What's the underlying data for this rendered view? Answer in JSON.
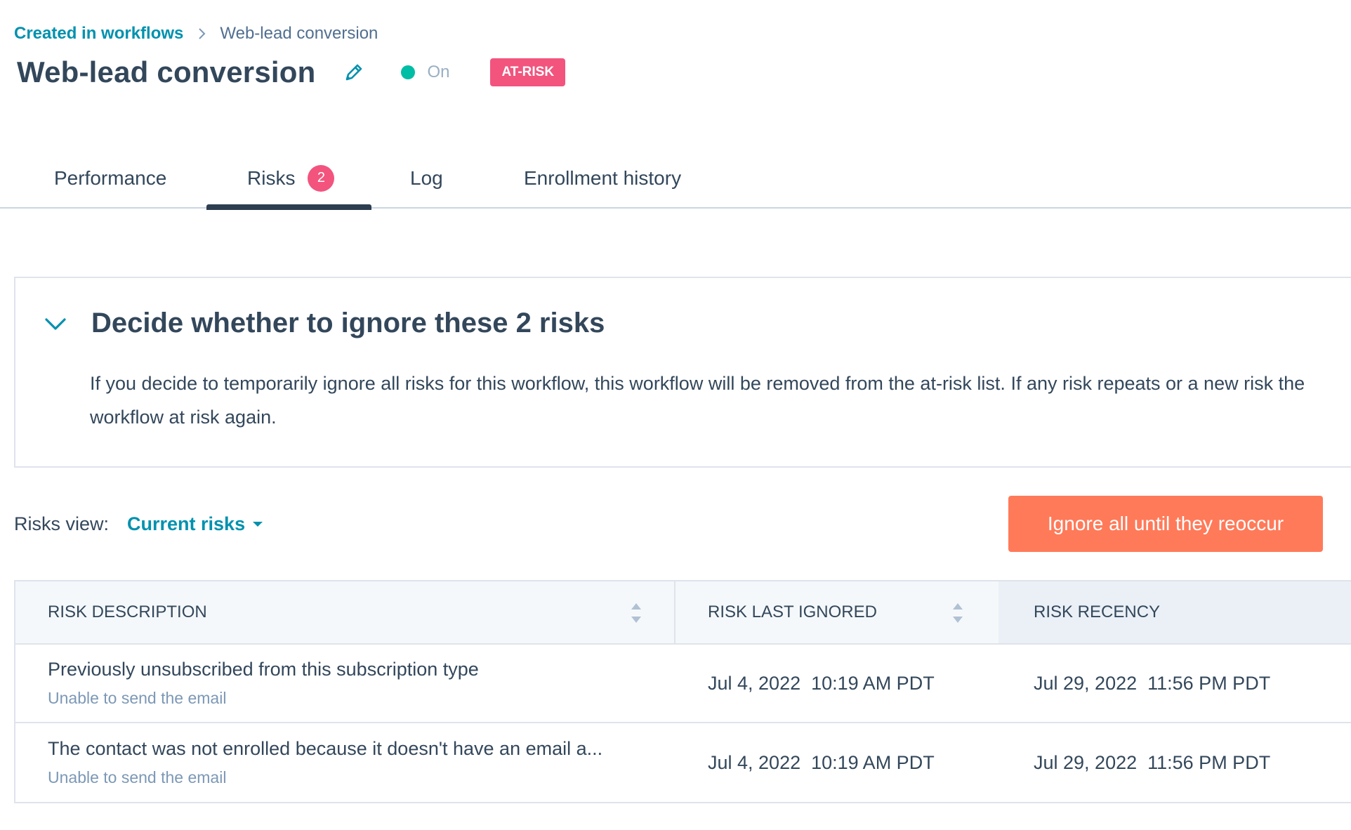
{
  "breadcrumb": {
    "parent": "Created in workflows",
    "current": "Web-lead conversion"
  },
  "header": {
    "title": "Web-lead conversion",
    "status": "On",
    "badge": "AT-RISK"
  },
  "tabs": [
    {
      "label": "Performance"
    },
    {
      "label": "Risks",
      "count": "2",
      "active": true
    },
    {
      "label": "Log"
    },
    {
      "label": "Enrollment history"
    }
  ],
  "alert": {
    "title": "Decide whether to ignore these 2 risks",
    "body": "If you decide to temporarily ignore all risks for this workflow, this workflow will be removed from the at-risk list. If any risk repeats or a new risk the workflow at risk again."
  },
  "risks_view": {
    "label": "Risks view:",
    "selected": "Current risks"
  },
  "ignore_button": "Ignore all until they reoccur",
  "table": {
    "columns": [
      "RISK DESCRIPTION",
      "RISK LAST IGNORED",
      "RISK RECENCY"
    ],
    "rows": [
      {
        "description": "Previously unsubscribed from this subscription type",
        "sub": "Unable to send the email",
        "last_ignored": "Jul 4, 2022  10:19 AM PDT",
        "recency": "Jul 29, 2022  11:56 PM PDT"
      },
      {
        "description": "The contact was not enrolled because it doesn't have an email a...",
        "sub": "Unable to send the email",
        "last_ignored": "Jul 4, 2022  10:19 AM PDT",
        "recency": "Jul 29, 2022  11:56 PM PDT"
      }
    ]
  },
  "colors": {
    "link": "#0091ae",
    "text": "#33475b",
    "status_on": "#00bda5",
    "badge": "#f2547d",
    "primary_button": "#ff7a59",
    "muted": "#7c98b6"
  },
  "icons": {
    "breadcrumb_separator": "chevron-right-icon",
    "edit": "pencil-icon",
    "collapse": "chevron-down-icon",
    "dropdown": "caret-down-icon",
    "sort": "sort-icon"
  }
}
